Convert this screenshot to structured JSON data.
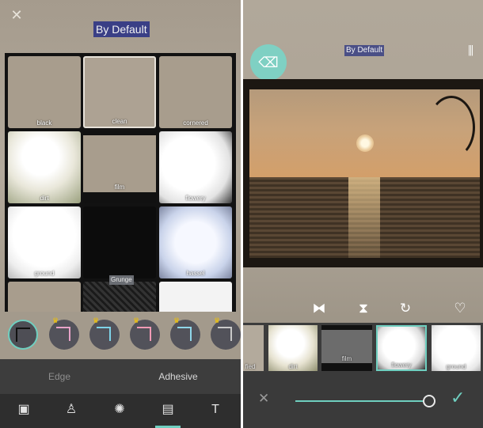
{
  "left": {
    "title": "By Default",
    "close_icon": "close-icon",
    "tiles": [
      "black",
      "clean",
      "cornered",
      "dirt",
      "film",
      "flowery",
      "ground",
      "",
      "hassel",
      "",
      "",
      ""
    ],
    "grunge_label": "Grunge",
    "tabs": [
      "Edge",
      "Adhesive"
    ],
    "active_tab": "Adhesive",
    "toolbar_icons": [
      "camera-icon",
      "brush-icon",
      "effects-icon",
      "frame-icon",
      "text-icon"
    ],
    "active_tool": "frame-icon",
    "accent": "#6fcfc0"
  },
  "right": {
    "title": "By Default",
    "eraser_icon": "eraser-icon",
    "compare_icon": "compare-icon",
    "actions": [
      "flip-horizontal-icon",
      "flip-vertical-icon",
      "rotate-icon",
      "heart-icon"
    ],
    "frames": [
      "fied",
      "dirt",
      "film",
      "flowery",
      "ground"
    ],
    "selected_frame": "flowery",
    "slider_value": 1.0,
    "cancel_icon": "cancel-icon",
    "confirm_icon": "checkmark-icon"
  }
}
